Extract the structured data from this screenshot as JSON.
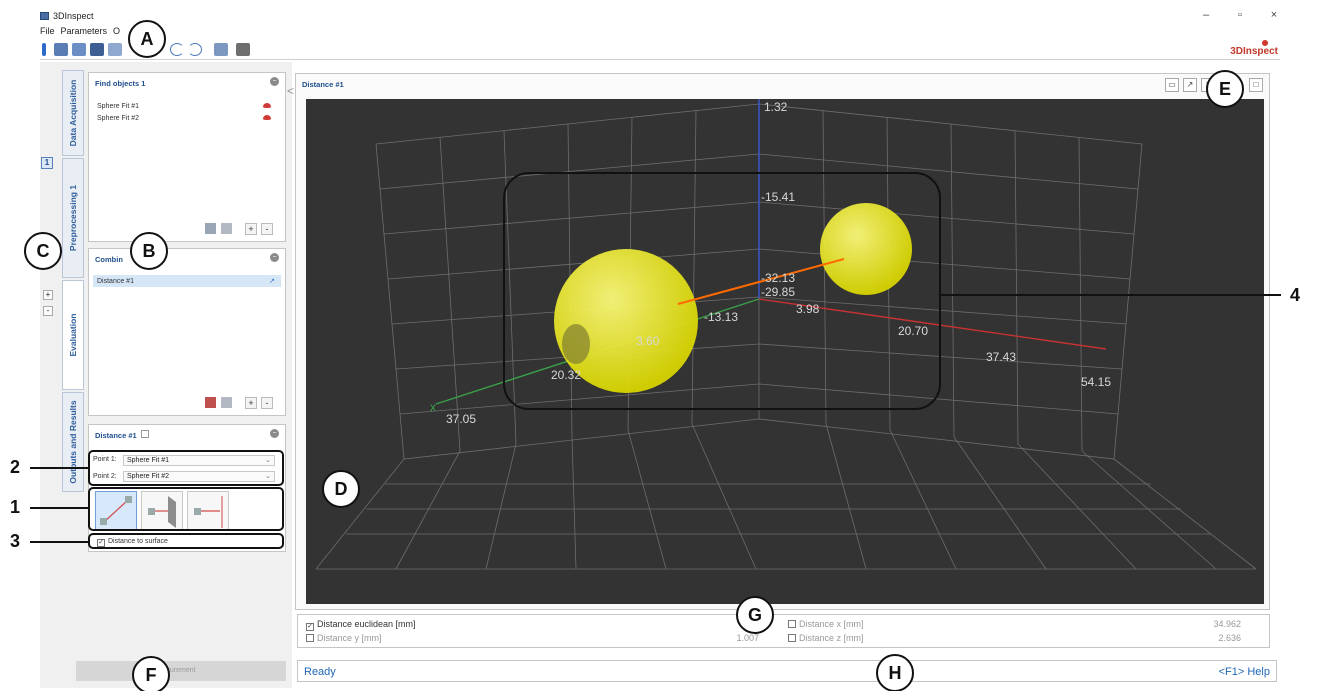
{
  "window": {
    "title": "3DInspect",
    "minimize": "–",
    "maximize": "▫",
    "close": "×",
    "brand": "3DInspect"
  },
  "menu": [
    "File",
    "Parameters",
    "O"
  ],
  "side_tabs": [
    "Data Acquisition",
    "Preprocessing 1",
    "Evaluation",
    "Outputs and Results"
  ],
  "side_number": "1",
  "side_plus": "+",
  "side_minus": "-",
  "find_objects": {
    "title": "Find objects 1",
    "items": [
      "Sphere Fit #1",
      "Sphere Fit #2"
    ],
    "add": "+",
    "remove": "-"
  },
  "combine": {
    "title": "Combin",
    "items": [
      "Distance #1"
    ],
    "add": "+",
    "remove": "-"
  },
  "distance_panel": {
    "title": "Distance #1",
    "point1_label": "Point 1:",
    "point1_value": "Sphere Fit #1",
    "point2_label": "Point 2:",
    "point2_value": "Sphere Fit #2",
    "checkbox_label": "Distance to surface",
    "checkbox_checked": true
  },
  "measure_button": "surement",
  "view": {
    "title": "Distance #1",
    "axis_labels": {
      "z_top": "1.32",
      "z_mid": "-15.41",
      "z_low": "-32.13",
      "origin_y": "-29.85",
      "neg": "-13.13",
      "a": "3.98",
      "b": "20.70",
      "c": "37.43",
      "d": "54.15",
      "e": "3.60",
      "f": "20.32",
      "g": "37.05",
      "x_axis": "x"
    }
  },
  "results": [
    {
      "label": "Distance euclidean [mm]",
      "value": "",
      "checked": true
    },
    {
      "label": "Distance x [mm]",
      "value": "34.962",
      "checked": false
    },
    {
      "label": "Distance y [mm]",
      "value": "1.007",
      "checked": false
    },
    {
      "label": "Distance z [mm]",
      "value": "2.636",
      "checked": false
    }
  ],
  "status": {
    "text": "Ready",
    "help": "<F1> Help"
  },
  "callouts": [
    "A",
    "B",
    "C",
    "D",
    "E",
    "F",
    "G",
    "H"
  ],
  "numbers": [
    "1",
    "2",
    "3",
    "4"
  ],
  "colors": {
    "accent": "#1f4e8c",
    "sphere": "#e8e600",
    "axis_x": "#3aa14a",
    "axis_y": "#c83232",
    "axis_z": "#3a5ad8",
    "distance_line": "#ff6a00"
  }
}
